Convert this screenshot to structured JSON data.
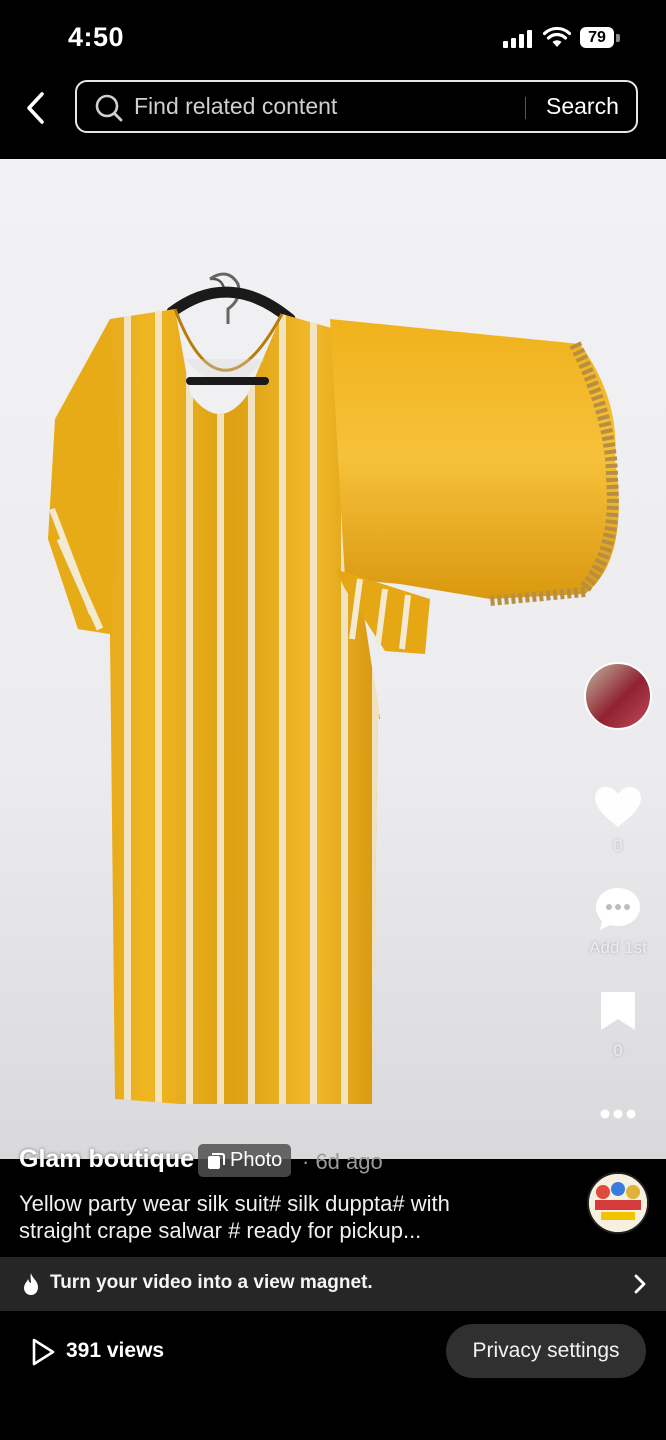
{
  "status_bar": {
    "time": "4:50",
    "battery": "79"
  },
  "search": {
    "placeholder": "Find related content",
    "button_label": "Search"
  },
  "post": {
    "account_name": "Glam boutique",
    "type_badge": "Photo",
    "time_ago": "· 6d ago",
    "caption_line1": "Yellow party wear silk suit# silk duppta# with",
    "caption_line2": "straight crape salwar # ready for pickup..."
  },
  "rail": {
    "likes": "0",
    "comments": "Add 1st",
    "saves": "0"
  },
  "promo": {
    "text": "Turn your video into a view magnet."
  },
  "footer": {
    "views": "391 views",
    "privacy_label": "Privacy settings"
  },
  "colors": {
    "suit_yellow": "#e7a812",
    "background": "#000000"
  }
}
